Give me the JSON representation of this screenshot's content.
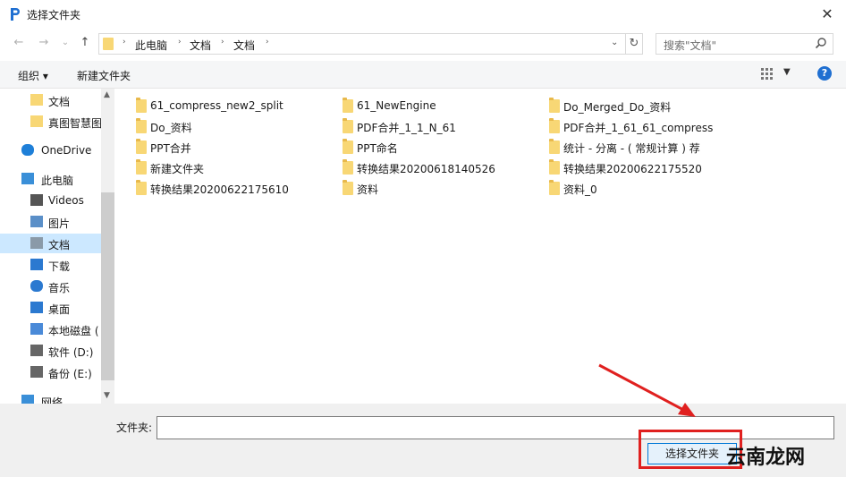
{
  "window": {
    "title": "选择文件夹",
    "close_glyph": "✕"
  },
  "nav": {
    "back_glyph": "←",
    "forward_glyph": "→",
    "recent_glyph": "⌄",
    "up_glyph": "↑",
    "breadcrumbs": [
      "此电脑",
      "文档",
      "文档"
    ],
    "refresh_glyph": "↻",
    "search_placeholder": "搜索\"文档\""
  },
  "toolbar": {
    "organize_label": "组织 ▾",
    "new_folder_label": "新建文件夹",
    "help_glyph": "?"
  },
  "sidebar": {
    "items": [
      {
        "label": "文档",
        "icon": "folder-icon"
      },
      {
        "label": "真图智慧图",
        "icon": "folder-icon"
      },
      {
        "label": "OneDrive",
        "icon": "cloud-icon"
      },
      {
        "label": "此电脑",
        "icon": "computer-icon"
      },
      {
        "label": "Videos",
        "icon": "video-icon"
      },
      {
        "label": "图片",
        "icon": "picture-icon"
      },
      {
        "label": "文档",
        "icon": "document-icon"
      },
      {
        "label": "下载",
        "icon": "download-icon"
      },
      {
        "label": "音乐",
        "icon": "music-icon"
      },
      {
        "label": "桌面",
        "icon": "desktop-icon"
      },
      {
        "label": "本地磁盘 (",
        "icon": "disk-icon"
      },
      {
        "label": "软件 (D:)",
        "icon": "drive-icon"
      },
      {
        "label": "备份 (E:)",
        "icon": "drive-icon"
      },
      {
        "label": "网络",
        "icon": "network-icon"
      }
    ]
  },
  "files": [
    "61_compress_new2_split",
    "61_NewEngine",
    "Do_Merged_Do_资料",
    "Do_资料",
    "PDF合并_1_1_N_61",
    "PDF合并_1_61_61_compress",
    "PPT合并",
    "PPT命名",
    "统计 - 分离 - ( 常规计算 )  荐",
    "新建文件夹",
    "转换结果20200618140526",
    "转换结果20200622175520",
    "转换结果20200622175610",
    "资料",
    "资料_0"
  ],
  "bottom": {
    "folder_label": "文件夹:",
    "folder_value": "",
    "select_button": "选择文件夹"
  },
  "watermark": "云南龙网",
  "colors": {
    "selected_bg": "#cce8ff",
    "folder": "#f8d775",
    "accent": "#0078d7",
    "highlight": "#e0201f"
  }
}
